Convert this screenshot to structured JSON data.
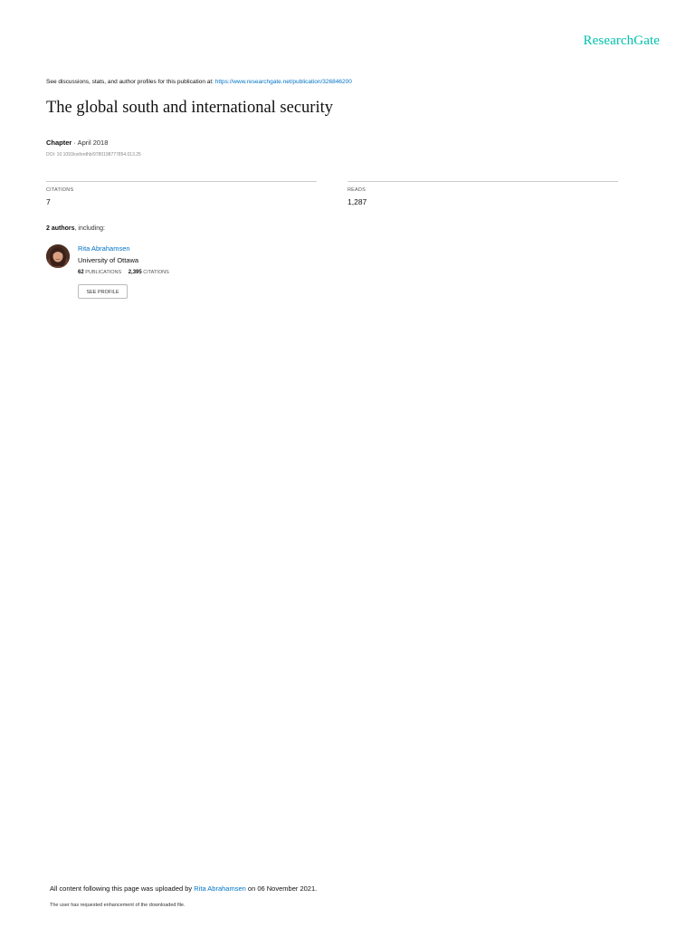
{
  "brand": {
    "name": "ResearchGate",
    "color": "#00c2ad"
  },
  "discussions": {
    "prefix": "See discussions, stats, and author profiles for this publication at: ",
    "url": "https://www.researchgate.net/publication/326846200"
  },
  "publication": {
    "title": "The global south and international security",
    "kind": "Chapter",
    "separator": " · ",
    "date": "April 2018",
    "doi": "DOI: 10.1093/oxfordhb/9780198777854.013.25"
  },
  "stats": {
    "citations_label": "CITATIONS",
    "citations_value": "7",
    "reads_label": "READS",
    "reads_value": "1,287"
  },
  "authors": {
    "count": "2 authors",
    "suffix": ", including:",
    "items": [
      {
        "name": "Rita Abrahamsen",
        "institution": "University of Ottawa",
        "publications_count": "62",
        "publications_label": "PUBLICATIONS",
        "citations_count": "2,395",
        "citations_label": "CITATIONS",
        "button_label": "SEE PROFILE",
        "avatar_icon": "author-photo"
      }
    ]
  },
  "footer": {
    "upload_prefix": "All content following this page was uploaded by ",
    "uploader": "Rita Abrahamsen",
    "upload_suffix": " on 06 November 2021.",
    "note": "The user has requested enhancement of the downloaded file."
  },
  "colors": {
    "link": "#0073c6",
    "text": "#111111",
    "divider": "#cccccc"
  }
}
